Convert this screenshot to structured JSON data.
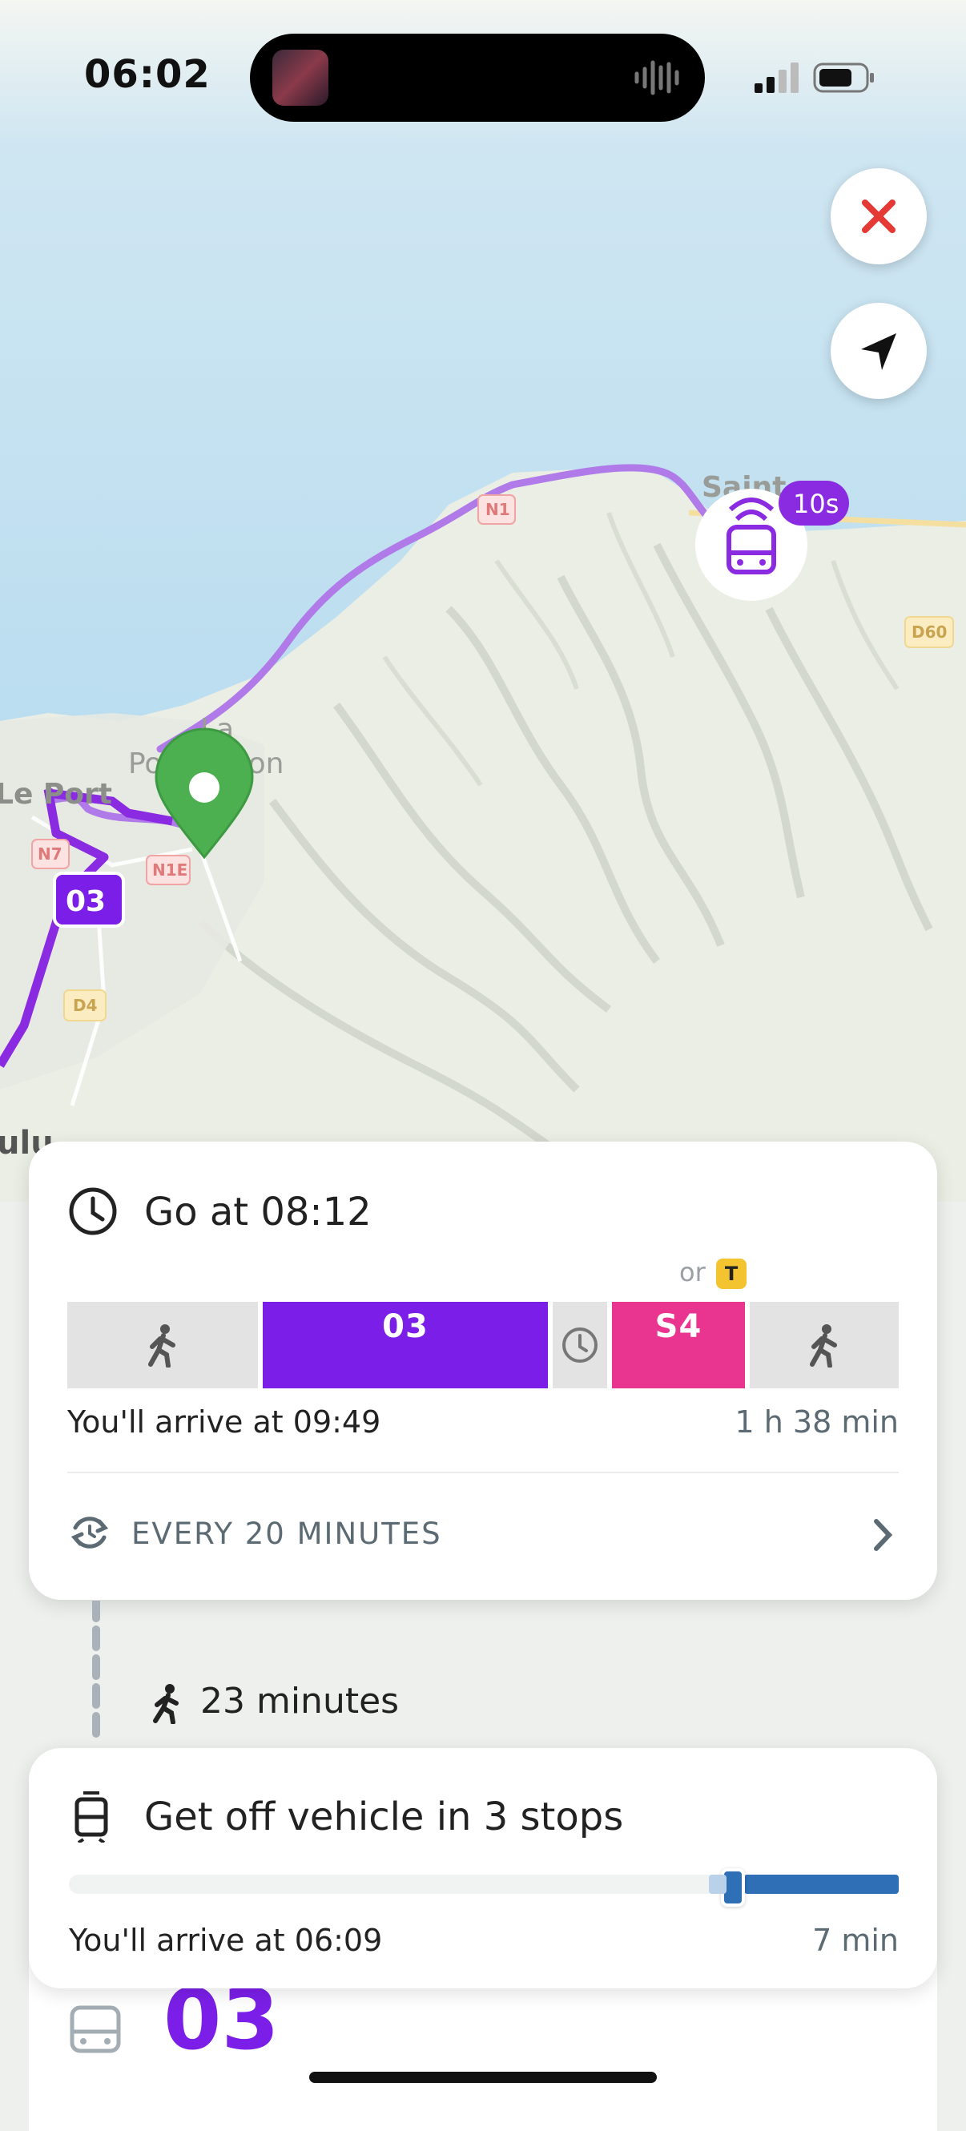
{
  "status_bar": {
    "time": "06:02"
  },
  "map": {
    "labels": {
      "la": "La",
      "possession": "Possession",
      "le_port": "Le Port",
      "saint_partial": "Saint",
      "bottom_partial": "ulu"
    },
    "road_shields": [
      "N1",
      "N7",
      "N1E",
      "D4",
      "D60"
    ],
    "route_badge": "03",
    "vehicle_badge": "10s",
    "colors": {
      "route": "#8a2be2",
      "route_light": "#b07ae8",
      "pin": "#4caf50",
      "sea": "#bfe0f0",
      "land": "#eaeee4"
    }
  },
  "trip_card": {
    "title": "Go at 08:12",
    "alt_or": "or",
    "alt_badge": "T",
    "segments": [
      {
        "type": "walk",
        "icon": "walk-icon"
      },
      {
        "type": "line",
        "label": "03",
        "color": "#7b1fe8"
      },
      {
        "type": "wait",
        "icon": "clock-icon"
      },
      {
        "type": "line",
        "label": "S4",
        "color": "#ea3590"
      },
      {
        "type": "walk",
        "icon": "walk-icon"
      }
    ],
    "arrival": "You'll arrive at 09:49",
    "duration": "1 h 38 min",
    "frequency": "EVERY 20 MINUTES"
  },
  "walk_step": {
    "duration": "23 minutes"
  },
  "ride_card": {
    "title": "Get off vehicle in 3 stops",
    "progress": 0.8,
    "arrival": "You'll arrive at 06:09",
    "duration": "7 min"
  },
  "bottom_panel": {
    "line": "03"
  }
}
